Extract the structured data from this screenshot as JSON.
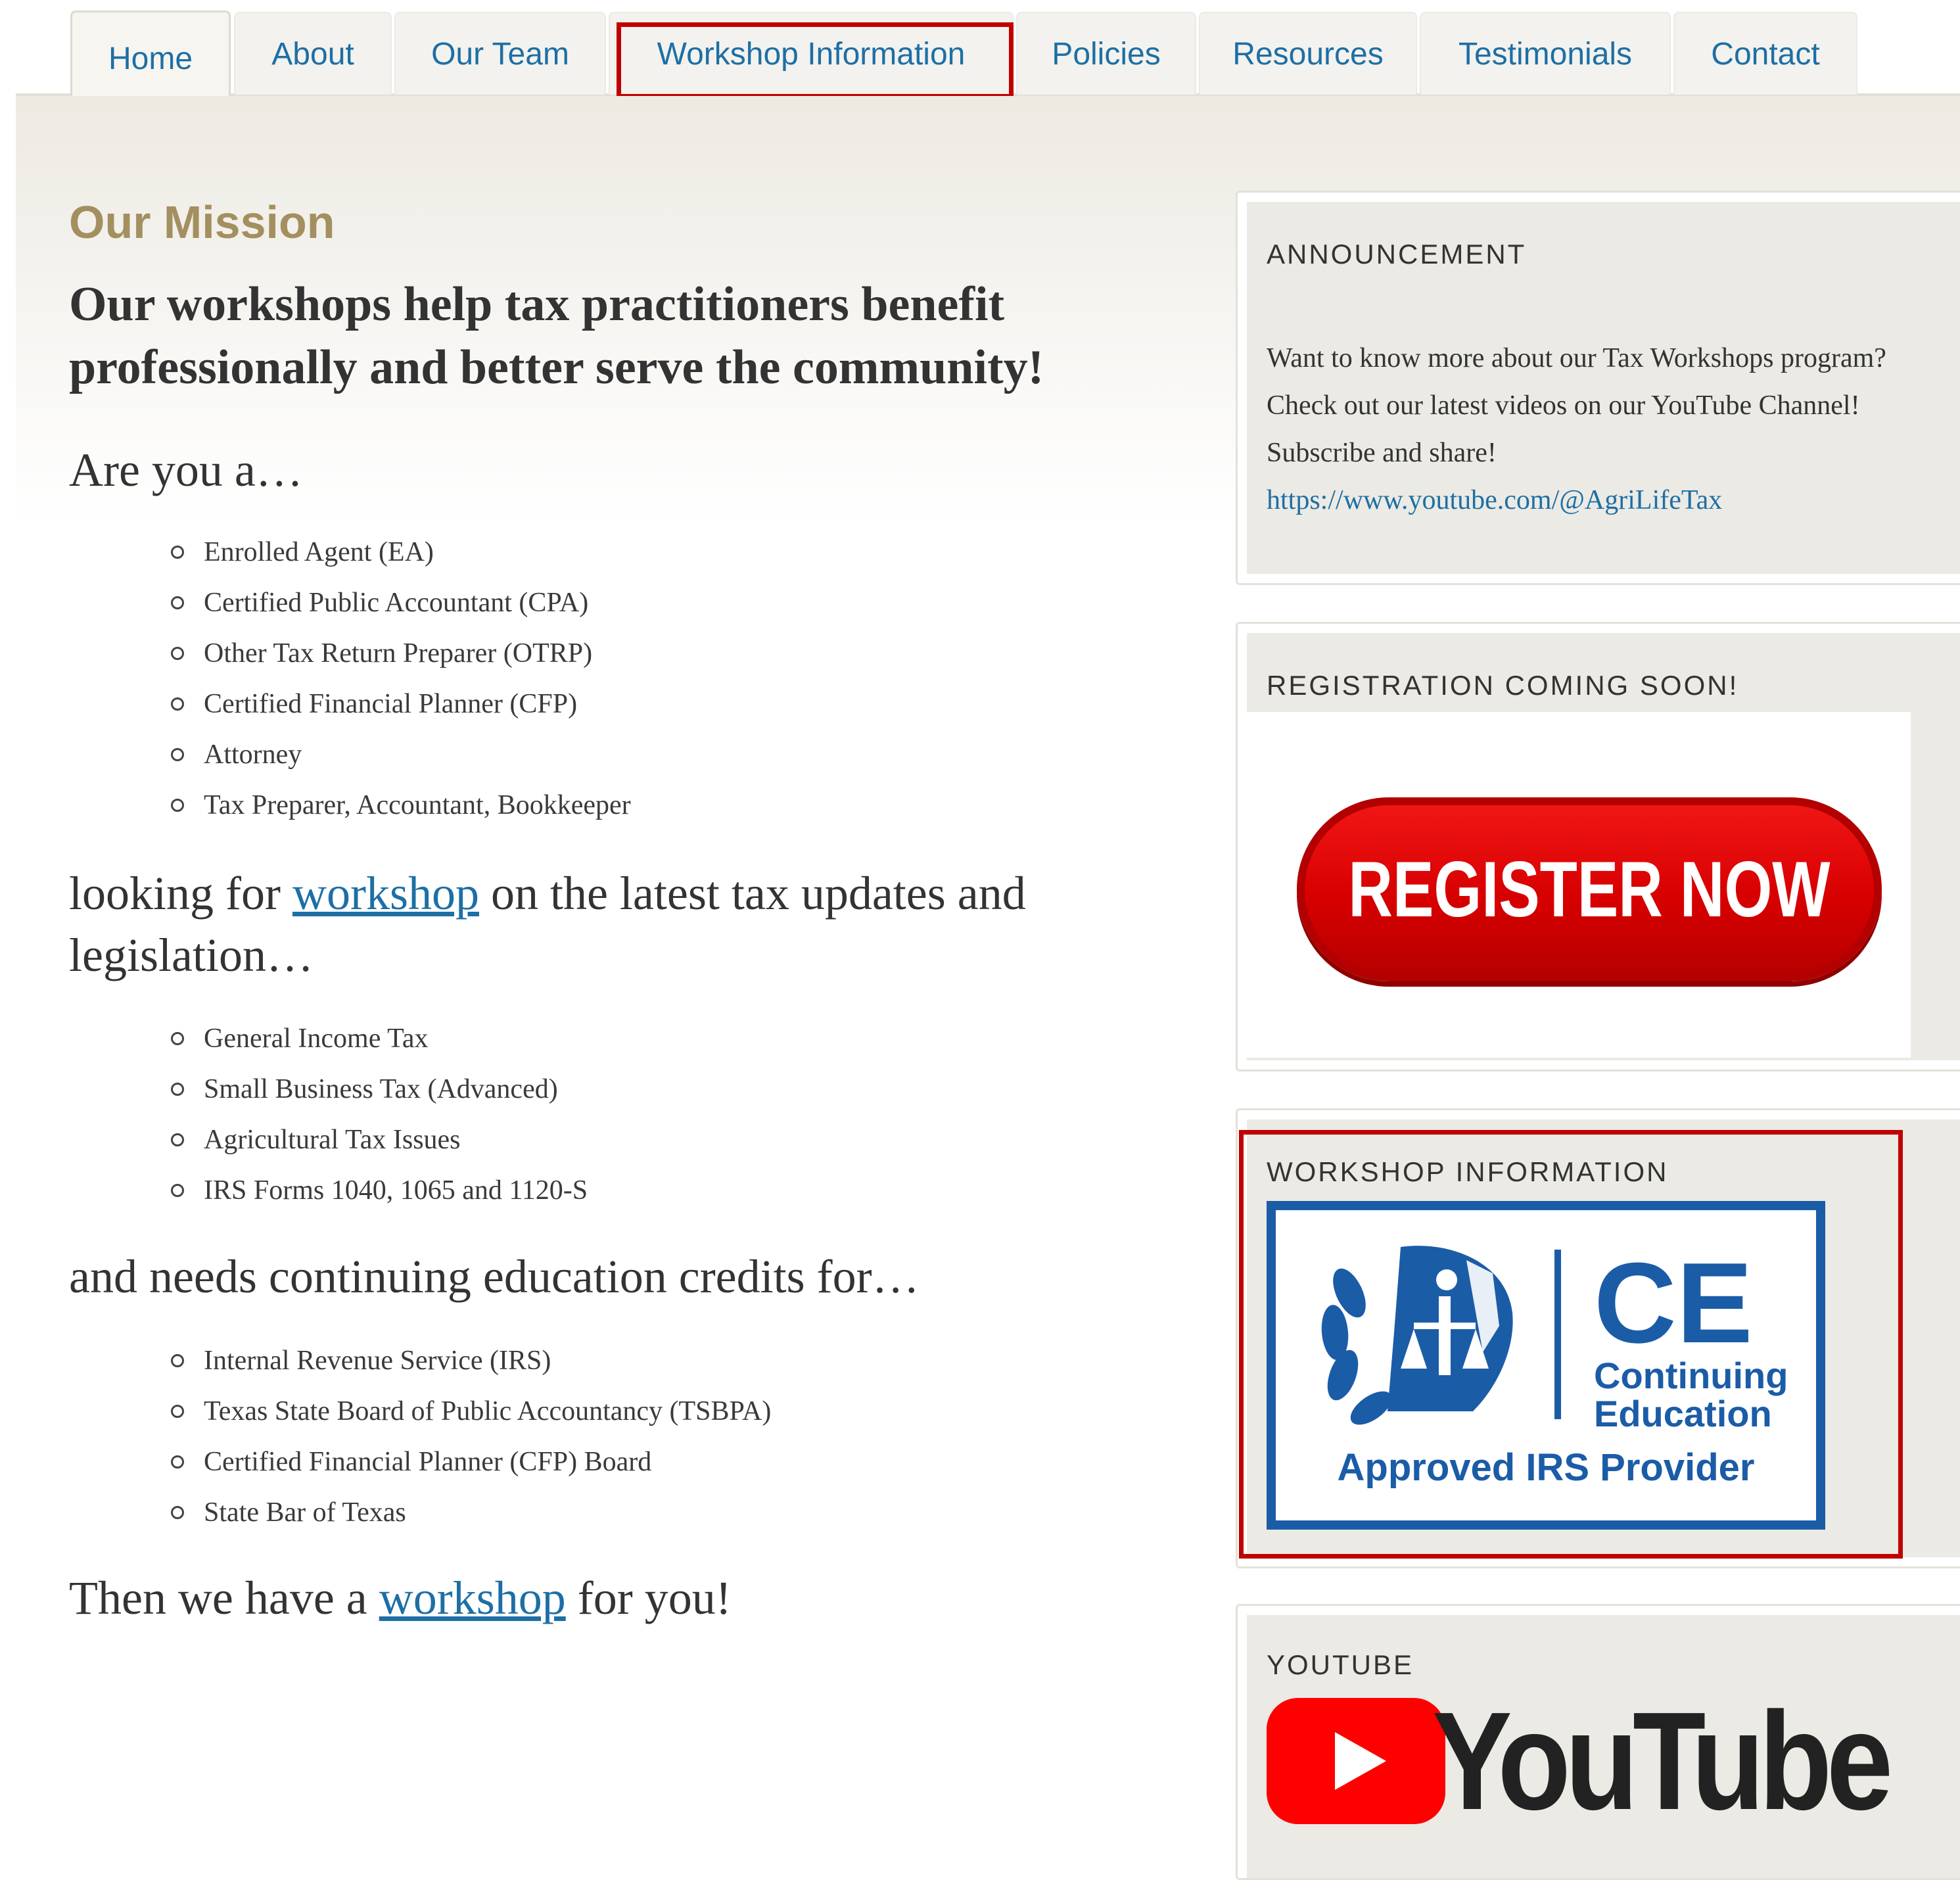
{
  "nav": {
    "tabs": [
      {
        "label": "Home",
        "active": true
      },
      {
        "label": "About"
      },
      {
        "label": "Our Team"
      },
      {
        "label": "Workshop Information",
        "highlighted": true
      },
      {
        "label": "Policies"
      },
      {
        "label": "Resources"
      },
      {
        "label": "Testimonials"
      },
      {
        "label": "Contact"
      }
    ]
  },
  "main": {
    "mission_title": "Our Mission",
    "lead": "Our workshops help tax practitioners benefit professionally and better serve the community!",
    "intro_question": "Are you a…",
    "roles": [
      "Enrolled Agent (EA)",
      "Certified Public Accountant (CPA)",
      "Other Tax Return Preparer (OTRP)",
      "Certified Financial Planner (CFP)",
      "Attorney",
      "Tax Preparer, Accountant, Bookkeeper"
    ],
    "looking_for": {
      "before": "looking for ",
      "link": "workshop",
      "after": " on the latest tax updates and legislation…"
    },
    "topics": [
      "General Income Tax",
      "Small Business Tax (Advanced)",
      "Agricultural Tax Issues",
      "IRS Forms 1040, 1065 and 1120-S"
    ],
    "needs_credits": "and needs continuing education credits for…",
    "credit_bodies": [
      "Internal Revenue Service (IRS)",
      "Texas State Board of Public Accountancy (TSBPA)",
      "Certified Financial Planner (CFP) Board",
      "State Bar of Texas"
    ],
    "closing": {
      "before": "Then we have a ",
      "link": "workshop",
      "after": " for you!"
    }
  },
  "sidebar": {
    "announcement": {
      "title": "ANNOUNCEMENT",
      "body": "Want to know more about our Tax Workshops program? Check out our latest videos on our YouTube Channel! Subscribe and share!",
      "link": "https://www.youtube.com/@AgriLifeTax"
    },
    "registration": {
      "title": "REGISTRATION COMING SOON!",
      "button_label": "REGISTER NOW"
    },
    "workshop_info": {
      "title": "WORKSHOP INFORMATION",
      "badge_big": "CE",
      "badge_line1": "Continuing",
      "badge_line2": "Education",
      "badge_approved": "Approved IRS Provider"
    },
    "youtube": {
      "title": "YOUTUBE",
      "wordmark": "YouTube"
    }
  },
  "colors": {
    "link": "#1d6fa5",
    "mission_title": "#a38f5f",
    "highlight": "#c00000",
    "irs_blue": "#1b5ca7",
    "register_red": "#d70000",
    "youtube_red": "#ff0000"
  }
}
